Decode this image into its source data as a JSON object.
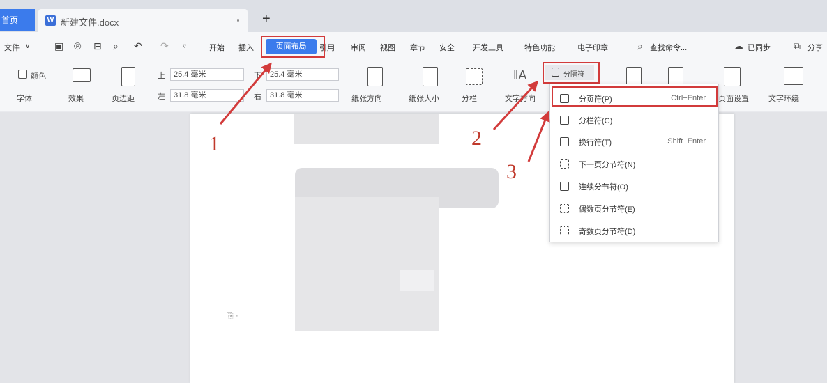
{
  "tabs": {
    "home_label": "首页",
    "doc_name": "新建文件.docx",
    "new_tab": "+"
  },
  "menu": {
    "file": "文件",
    "items": [
      "开始",
      "插入",
      "页面布局",
      "引用",
      "审阅",
      "视图",
      "章节",
      "安全",
      "开发工具",
      "特色功能",
      "电子印章"
    ],
    "search": "查找命令...",
    "sync": "已同步",
    "share": "分享"
  },
  "ribbon": {
    "color_label": "颜色",
    "font_label": "字体",
    "effect_label": "效果",
    "margin_label": "页边距",
    "top_label": "上",
    "bottom_label": "下",
    "left_label": "左",
    "right_label": "右",
    "top_value": "25.4 毫米",
    "bottom_value": "25.4 毫米",
    "left_value": "31.8 毫米",
    "right_value": "31.8 毫米",
    "orientation": "纸张方向",
    "size": "纸张大小",
    "columns": "分栏",
    "text_dir": "文字方向",
    "breaks_button": "分隔符",
    "page_setup": "页面设置",
    "text_wrap": "文字环绕"
  },
  "breaks_menu": [
    {
      "label": "分页符(P)",
      "shortcut": "Ctrl+Enter",
      "icon": "page-break-icon"
    },
    {
      "label": "分栏符(C)",
      "shortcut": "",
      "icon": "column-break-icon"
    },
    {
      "label": "换行符(T)",
      "shortcut": "Shift+Enter",
      "icon": "line-break-icon"
    },
    {
      "label": "下一页分节符(N)",
      "shortcut": "",
      "icon": "next-page-section-icon"
    },
    {
      "label": "连续分节符(O)",
      "shortcut": "",
      "icon": "continuous-section-icon"
    },
    {
      "label": "偶数页分节符(E)",
      "shortcut": "",
      "icon": "even-page-section-icon"
    },
    {
      "label": "奇数页分节符(D)",
      "shortcut": "",
      "icon": "odd-page-section-icon"
    }
  ],
  "annotations": [
    "1",
    "2",
    "3"
  ],
  "colors": {
    "accent": "#3b7bec",
    "highlight": "#d23b3b"
  }
}
